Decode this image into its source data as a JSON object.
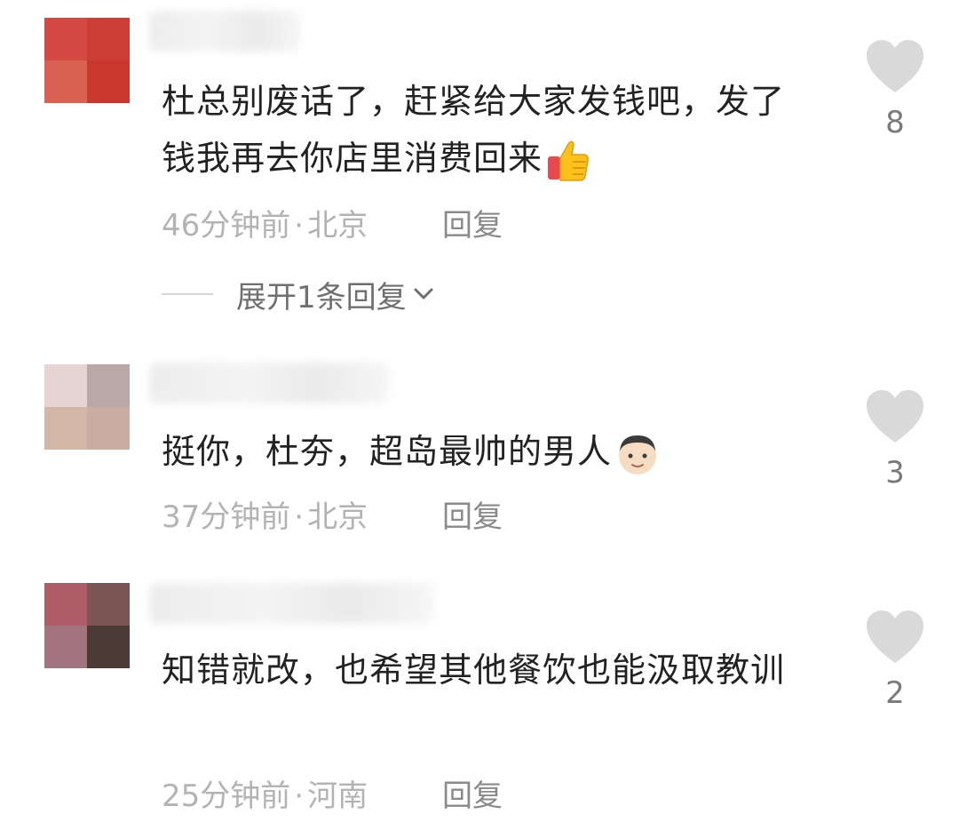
{
  "comments": [
    {
      "text": "杜总别废话了，赶紧给大家发钱吧，发了钱我再去你店里消费回来",
      "emoji": "thumbs-up-icon",
      "time": "46分钟前",
      "location": "北京",
      "reply_label": "回复",
      "likes": "8",
      "expand_label": "展开1条回复",
      "avatar_colors": [
        "#d44a42",
        "#cc3e35",
        "#d86152",
        "#c9372f"
      ]
    },
    {
      "text": "挺你，杜夯，超岛最帅的男人",
      "emoji": "man-face-icon",
      "time": "37分钟前",
      "location": "北京",
      "reply_label": "回复",
      "likes": "3",
      "avatar_colors": [
        "#e6d4d2",
        "#b9a8a6",
        "#d2b6a6",
        "#c9ada1"
      ]
    },
    {
      "text": "知错就改，也希望其他餐饮也能汲取教训",
      "time": "25分钟前",
      "location": "河南",
      "reply_label": "回复",
      "likes": "2",
      "avatar_colors": [
        "#ad5c68",
        "#7a5553",
        "#a17480",
        "#4c3a36"
      ]
    }
  ],
  "colors": {
    "like_heart": "#d9d9d9",
    "meta_text": "#b3b3b3"
  },
  "meta_separator": "·"
}
